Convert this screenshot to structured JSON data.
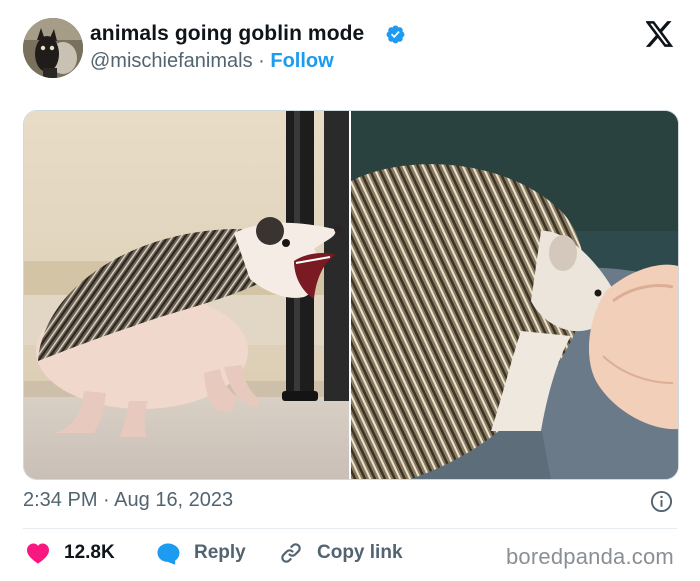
{
  "author": {
    "display_name": "animals going goblin mode",
    "handle": "@mischiefanimals",
    "separator": "·",
    "follow_label": "Follow",
    "verified": true,
    "avatar_icon": "goblin-animal-avatar"
  },
  "brand_icon": "x-logo-icon",
  "media": {
    "images": [
      {
        "name": "hedgehog-screaming-image",
        "icon": "hedgehog-open-mouth"
      },
      {
        "name": "hedgehog-biting-finger-image",
        "icon": "hedgehog-biting-finger"
      }
    ]
  },
  "meta": {
    "time": "2:34 PM",
    "separator": "·",
    "date": "Aug 16, 2023"
  },
  "actions": {
    "like_count": "12.8K",
    "reply_label": "Reply",
    "copy_link_label": "Copy link"
  },
  "watermark": "boredpanda.com",
  "colors": {
    "accent": "#1d9bf0",
    "like": "#f91880",
    "text": "#0f1419",
    "secondary": "#536471",
    "verified": "#1d9bf0"
  }
}
